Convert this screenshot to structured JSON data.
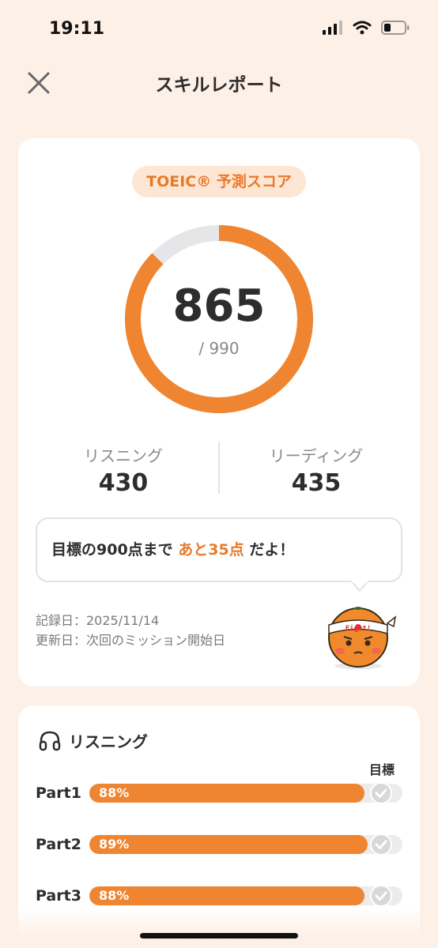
{
  "status": {
    "time": "19:11"
  },
  "header": {
    "title": "スキルレポート"
  },
  "score": {
    "badge": "TOEIC® 予測スコア",
    "value": "865",
    "max_label": "/ 990",
    "score_num": 865,
    "max_num": 990,
    "listening_label": "リスニング",
    "listening_value": "430",
    "reading_label": "リーディング",
    "reading_value": "435"
  },
  "message": {
    "prefix": "目標の900点まで ",
    "highlight": "あと35点",
    "suffix": " だよ！"
  },
  "meta": {
    "recorded": "記録日：2025/11/14",
    "updated": "更新日：次回のミッション開始日"
  },
  "mascot": {
    "headband": "Fight!"
  },
  "listening": {
    "title": "リスニング",
    "goal_label": "目標",
    "parts": [
      {
        "label": "Part1",
        "percent_label": "88%",
        "percent": 88
      },
      {
        "label": "Part2",
        "percent_label": "89%",
        "percent": 89
      },
      {
        "label": "Part3",
        "percent_label": "88%",
        "percent": 88
      }
    ]
  },
  "colors": {
    "accent": "#ef8530",
    "background": "#fdf0e6",
    "badge_bg": "#fde6d3"
  }
}
